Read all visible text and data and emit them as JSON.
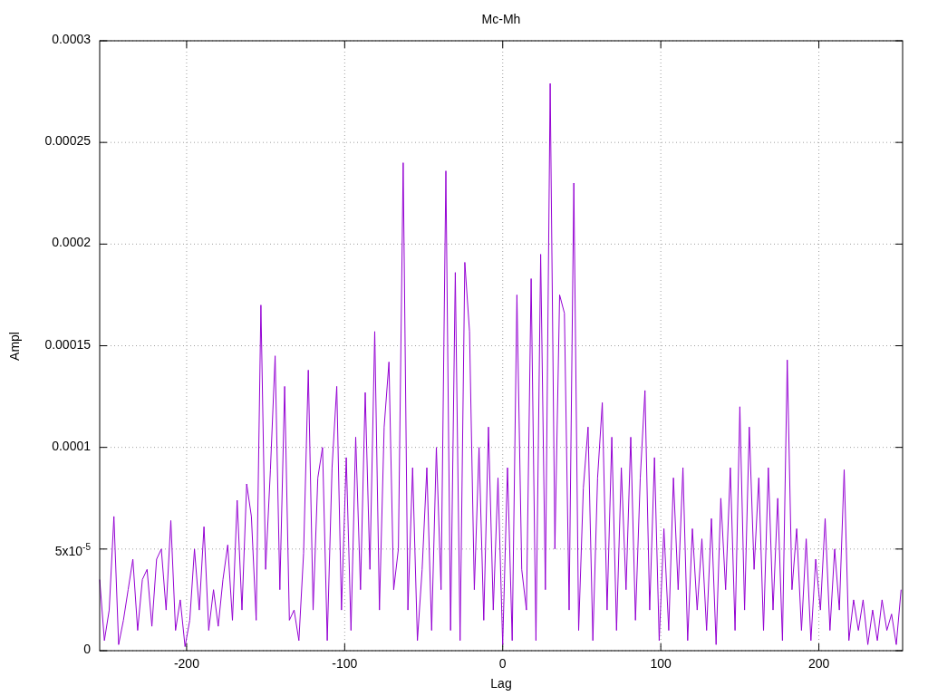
{
  "chart": {
    "chart_data": {
      "type": "line",
      "grid": true,
      "title": "Mc-Mh",
      "xlabel": "Lag",
      "ylabel": "Ampl",
      "xlim": [
        -255,
        253
      ],
      "ylim": [
        0,
        0.0003
      ],
      "xticks": [
        -200,
        -100,
        0,
        100,
        200
      ],
      "yticks": [
        0,
        {
          "value": 5e-05,
          "label": "5x10$^{-5}$"
        },
        0.0001,
        0.00015,
        0.0002,
        0.00025,
        0.0003
      ],
      "x": [
        -255,
        -252,
        -249,
        -246,
        -243,
        -240,
        -237,
        -234,
        -231,
        -228,
        -225,
        -222,
        -219,
        -216,
        -213,
        -210,
        -207,
        -204,
        -201,
        -198,
        -195,
        -192,
        -189,
        -186,
        -183,
        -180,
        -177,
        -174,
        -171,
        -168,
        -165,
        -162,
        -159,
        -156,
        -153,
        -150,
        -147,
        -144,
        -141,
        -138,
        -135,
        -132,
        -129,
        -126,
        -123,
        -120,
        -117,
        -114,
        -111,
        -108,
        -105,
        -102,
        -99,
        -96,
        -93,
        -90,
        -87,
        -84,
        -81,
        -78,
        -75,
        -72,
        -69,
        -66,
        -63,
        -60,
        -57,
        -54,
        -51,
        -48,
        -45,
        -42,
        -39,
        -36,
        -33,
        -30,
        -27,
        -24,
        -21,
        -18,
        -15,
        -12,
        -9,
        -6,
        -3,
        0,
        3,
        6,
        9,
        12,
        15,
        18,
        21,
        24,
        27,
        30,
        33,
        36,
        39,
        42,
        45,
        48,
        51,
        54,
        57,
        60,
        63,
        66,
        69,
        72,
        75,
        78,
        81,
        84,
        87,
        90,
        93,
        96,
        99,
        102,
        105,
        108,
        111,
        114,
        117,
        120,
        123,
        126,
        129,
        132,
        135,
        138,
        141,
        144,
        147,
        150,
        153,
        156,
        159,
        162,
        165,
        168,
        171,
        174,
        177,
        180,
        183,
        186,
        189,
        192,
        195,
        198,
        201,
        204,
        207,
        210,
        213,
        216,
        219,
        222,
        225,
        228,
        231,
        234,
        237,
        240,
        243,
        246,
        249,
        252
      ],
      "series": [
        {
          "color": "#9400d3",
          "values": [
            3.5e-05,
            5e-06,
            2e-05,
            6.6e-05,
            3e-06,
            1.5e-05,
            3e-05,
            4.5e-05,
            1e-05,
            3.5e-05,
            4e-05,
            1.2e-05,
            4.5e-05,
            5e-05,
            2e-05,
            6.4e-05,
            1e-05,
            2.5e-05,
            2e-06,
            1.5e-05,
            5e-05,
            2e-05,
            6.1e-05,
            1e-05,
            3e-05,
            1.2e-05,
            3.5e-05,
            5.2e-05,
            1.5e-05,
            7.4e-05,
            2e-05,
            8.2e-05,
            6.6e-05,
            1.5e-05,
            0.00017,
            4e-05,
            8.9e-05,
            0.000145,
            3e-05,
            0.00013,
            1.5e-05,
            2e-05,
            5e-06,
            4.8e-05,
            0.000138,
            2e-05,
            8.5e-05,
            0.0001,
            5e-06,
            9e-05,
            0.00013,
            2e-05,
            9.5e-05,
            1e-05,
            0.000105,
            3e-05,
            0.000127,
            4e-05,
            0.000157,
            2e-05,
            0.00011,
            0.000142,
            3e-05,
            5e-05,
            0.00024,
            2e-05,
            9e-05,
            5e-06,
            4e-05,
            9e-05,
            1e-05,
            0.0001,
            3e-05,
            0.000236,
            1e-05,
            0.000186,
            5e-06,
            0.000191,
            0.000157,
            3e-05,
            0.0001,
            1.5e-05,
            0.00011,
            2e-05,
            8.5e-05,
            3e-06,
            9e-05,
            5e-06,
            0.000175,
            4e-05,
            2e-05,
            0.000183,
            5e-06,
            0.000195,
            3e-05,
            0.000279,
            5e-05,
            0.000175,
            0.000166,
            2e-05,
            0.00023,
            1e-05,
            8e-05,
            0.00011,
            5e-06,
            8.5e-05,
            0.000122,
            2e-05,
            0.000105,
            1e-05,
            9e-05,
            3e-05,
            0.000105,
            1.5e-05,
            8.5e-05,
            0.000128,
            2e-05,
            9.5e-05,
            5e-06,
            6e-05,
            1e-05,
            8.5e-05,
            3e-05,
            9e-05,
            5e-06,
            6e-05,
            2e-05,
            5.5e-05,
            1e-05,
            6.5e-05,
            3e-06,
            7.5e-05,
            3e-05,
            9e-05,
            1e-05,
            0.00012,
            2e-05,
            0.00011,
            4e-05,
            8.5e-05,
            1e-05,
            9e-05,
            2e-05,
            7.5e-05,
            5e-06,
            0.000143,
            3e-05,
            6e-05,
            1e-05,
            5.5e-05,
            5e-06,
            4.5e-05,
            2e-05,
            6.5e-05,
            1e-05,
            5e-05,
            2e-05,
            8.9e-05,
            5e-06,
            2.5e-05,
            1e-05,
            2.5e-05,
            3e-06,
            2e-05,
            5e-06,
            2.5e-05,
            1e-05,
            1.8e-05,
            3e-06,
            3e-05
          ]
        }
      ]
    }
  }
}
